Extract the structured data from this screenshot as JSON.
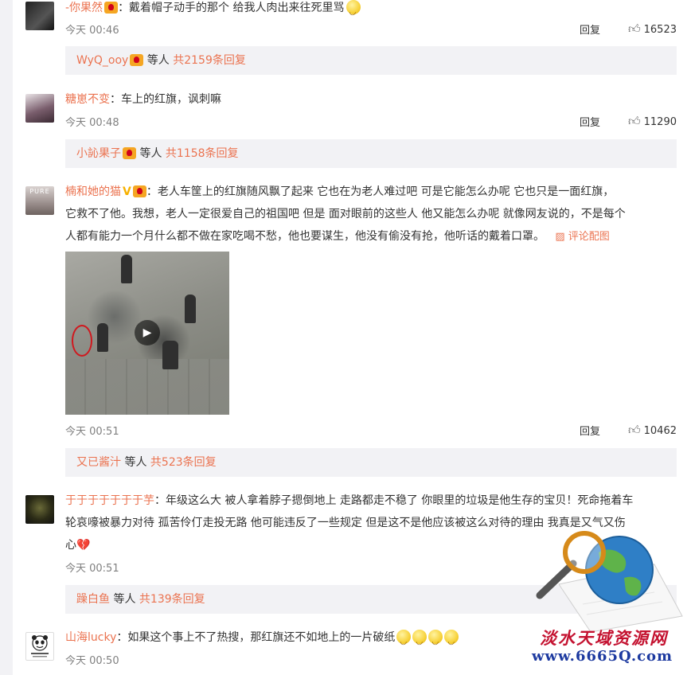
{
  "labels": {
    "reply": "回复",
    "and_others": "等人",
    "pic_link": "评论配图"
  },
  "colors": {
    "username": "#eb7350",
    "reply_bar_bg": "#f2f2f5",
    "page_bg": "#f2f2f5"
  },
  "comments": [
    {
      "username": "-你果然",
      "text": "：戴着帽子动手的那个 给我人肉出来往死里骂",
      "time": "今天 00:46",
      "likes": "16523",
      "reply_bar": {
        "user": "WyQ_ooy",
        "count_text": "共2159条回复"
      }
    },
    {
      "username": "糖崽不变",
      "text": "：车上的红旗，讽刺嘛",
      "time": "今天 00:48",
      "likes": "11290",
      "reply_bar": {
        "user": "小訫果子",
        "count_text": "共1158条回复"
      }
    },
    {
      "username": "楠和她的猫",
      "avatar_text": "PURE",
      "text_lines": [
        "：老人车筐上的红旗随风飘了起来 它也在为老人难过吧 可是它能怎么办呢  它也只是一面红旗，",
        "它救不了他。我想，老人一定很爱自己的祖国吧 但是 面对眼前的这些人 他又能怎么办呢 就像网友说的，不是每个",
        "人都有能力一个月什么都不做在家吃喝不愁，他也要谋生，他没有偷没有抢，他听话的戴着口罩。"
      ],
      "time": "今天 00:51",
      "likes": "10462",
      "reply_bar": {
        "user": "又已酱汁",
        "count_text": "共523条回复"
      }
    },
    {
      "username": "于于于于于于于芋",
      "text_lines": [
        "：年级这么大 被人拿着脖子摁倒地上 走路都走不稳了 你眼里的垃圾是他生存的宝贝！死命拖着车",
        "轮哀嚎被暴力对待 孤苦伶仃走投无路 他可能违反了一些规定 但是这不是他应该被这么对待的理由  我真是又气又伤",
        "心💔"
      ],
      "time": "今天 00:51",
      "reply_bar": {
        "user": "躁白鱼",
        "count_text": "共139条回复"
      }
    },
    {
      "username": "山海lucky",
      "text": "：如果这个事上不了热搜，那红旗还不如地上的一片破纸",
      "time": "今天 00:50"
    }
  ],
  "watermark": {
    "title": "淡水天域资源网",
    "url": "www.6665Q.com",
    "icon": "magnifier-globe-icon"
  }
}
